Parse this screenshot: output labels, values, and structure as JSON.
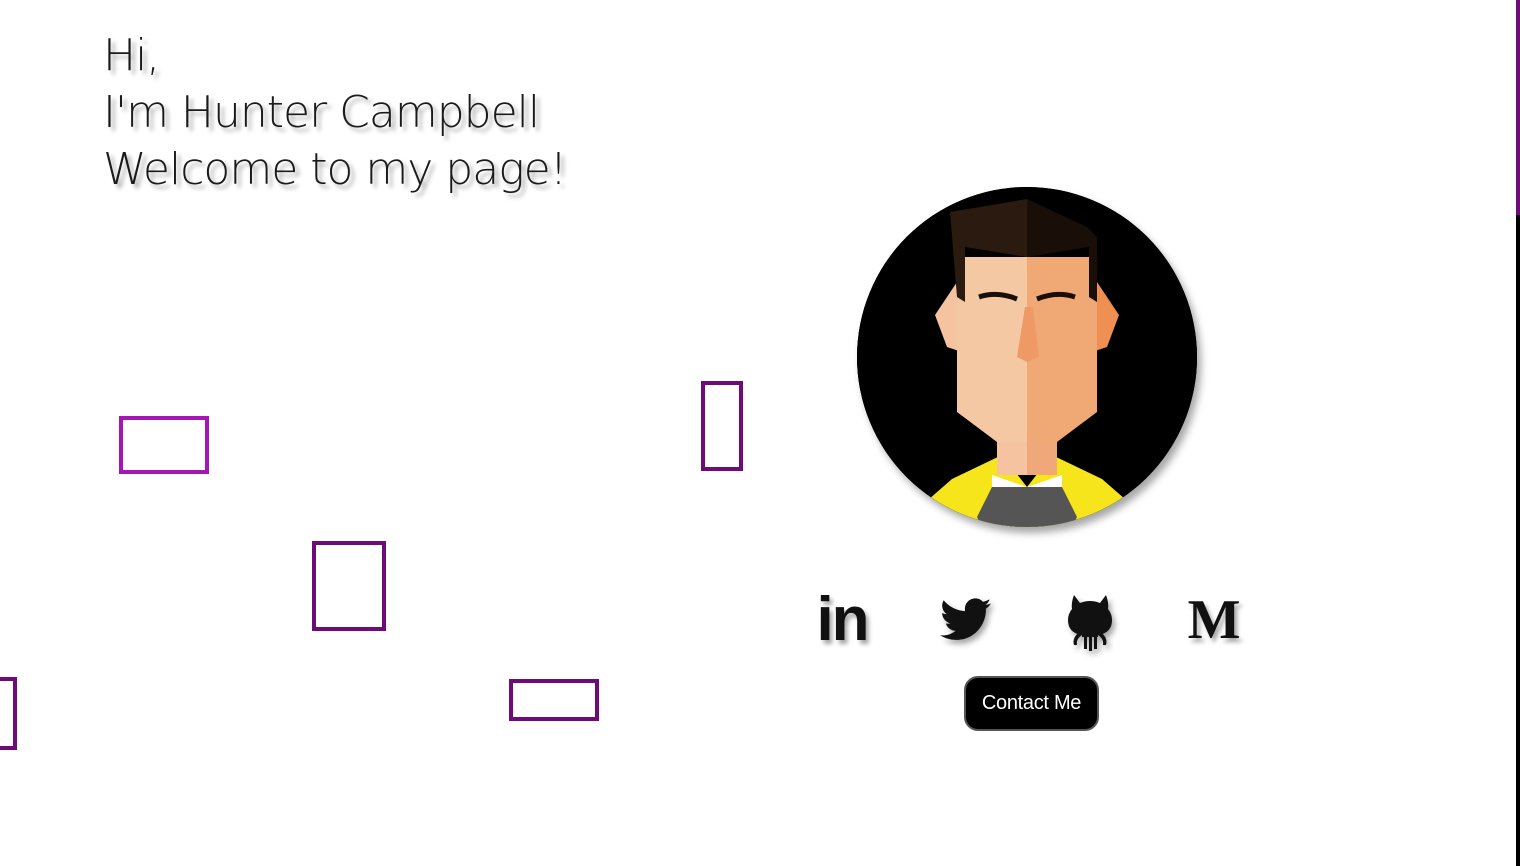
{
  "hero": {
    "line1": "Hi,",
    "line2": "I'm Hunter Campbell",
    "line3": "Welcome to my page!"
  },
  "social": [
    {
      "name": "linkedin",
      "icon": "linkedin-icon",
      "glyph": "in"
    },
    {
      "name": "twitter",
      "icon": "twitter-icon"
    },
    {
      "name": "github",
      "icon": "github-icon"
    },
    {
      "name": "medium",
      "icon": "medium-icon",
      "glyph": "M"
    }
  ],
  "contact": {
    "label": "Contact Me"
  },
  "colors": {
    "accent": "#6e0b78",
    "accent_bright": "#a615b5",
    "button_bg": "#000000",
    "button_text": "#ffffff"
  }
}
